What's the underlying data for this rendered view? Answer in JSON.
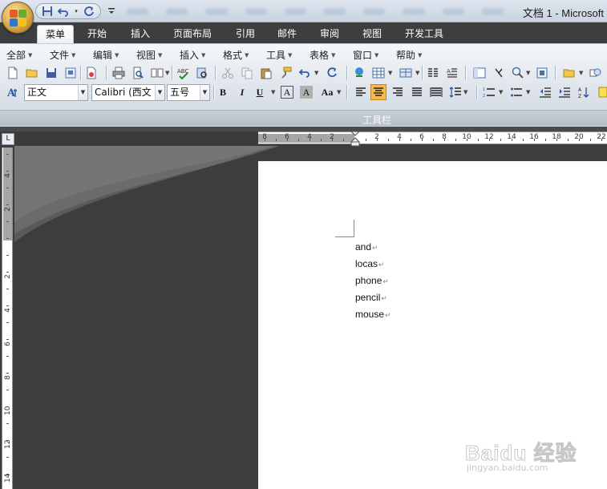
{
  "window": {
    "title": "文档 1 - Microsoft"
  },
  "tabs": [
    "菜单",
    "开始",
    "插入",
    "页面布局",
    "引用",
    "邮件",
    "审阅",
    "视图",
    "开发工具"
  ],
  "menus": [
    "全部",
    "文件",
    "编辑",
    "视图",
    "插入",
    "格式",
    "工具",
    "表格",
    "窗口",
    "帮助"
  ],
  "format": {
    "style_value": "正文",
    "font_value": "Calibri (西文",
    "size_value": "五号",
    "bold": "B",
    "italic": "I",
    "underline": "U",
    "font_color": "A",
    "highlight": "A",
    "change_case": "Aa"
  },
  "toolbar_group_label": "工具栏",
  "ruler_corner": "L",
  "hruler_numbers": [
    "8",
    "6",
    "4",
    "2",
    "2",
    "4",
    "6",
    "8",
    "10",
    "12",
    "14",
    "16",
    "18",
    "20",
    "22"
  ],
  "vruler_numbers": [
    "4",
    "2",
    "2",
    "4",
    "6",
    "8",
    "10",
    "12",
    "14"
  ],
  "document": {
    "lines": [
      "and",
      "locas",
      "phone",
      "pencil",
      "mouse"
    ],
    "para_mark": "↵"
  },
  "watermark": {
    "main": "Baidu 经验",
    "sub": "jingyan.baidu.com"
  },
  "colors": {
    "active_tab_bg": "#eef1f5",
    "tabbar_bg": "#3e3e3e",
    "workspace_bg": "#3d3d3d",
    "align_active": "#f7b84c"
  }
}
